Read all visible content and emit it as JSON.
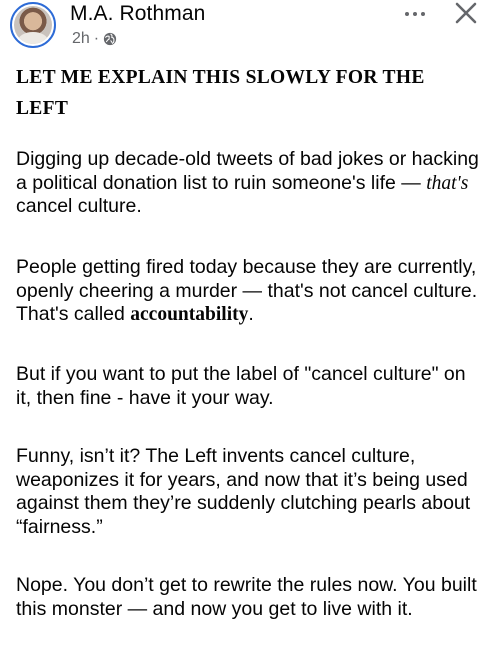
{
  "post": {
    "author": "M.A. Rothman",
    "time": "2h",
    "separator": "·",
    "audience_icon": "globe-icon",
    "more_icon": "ellipsis-icon",
    "close_icon": "close-icon",
    "headline_line1": "LET ME EXPLAIN THIS SLOWLY FOR THE",
    "headline_line2": "LEFT",
    "p1_pre": "Digging up decade-old tweets of bad jokes or hacking a political donation list to ruin someone's life — ",
    "p1_em": "that's",
    "p1_post": " cancel culture.",
    "p2_pre": "People getting fired today because they are currently, openly cheering a murder — that's not cancel culture. That's called ",
    "p2_bold": "accountability",
    "p2_post": ".",
    "p3": "But if you want to put the label of \"cancel culture\" on it, then fine - have it your way.",
    "p4": "Funny, isn’t it? The Left invents cancel culture, weaponizes it for years, and now that it’s being used against them they’re suddenly clutching pearls about “fairness.”",
    "p5": "Nope. You don’t get to rewrite the rules now. You built this monster — and now you get to live with it."
  },
  "colors": {
    "text": "#050505",
    "secondary": "#65676b",
    "avatar_ring": "#2d6bd6"
  }
}
